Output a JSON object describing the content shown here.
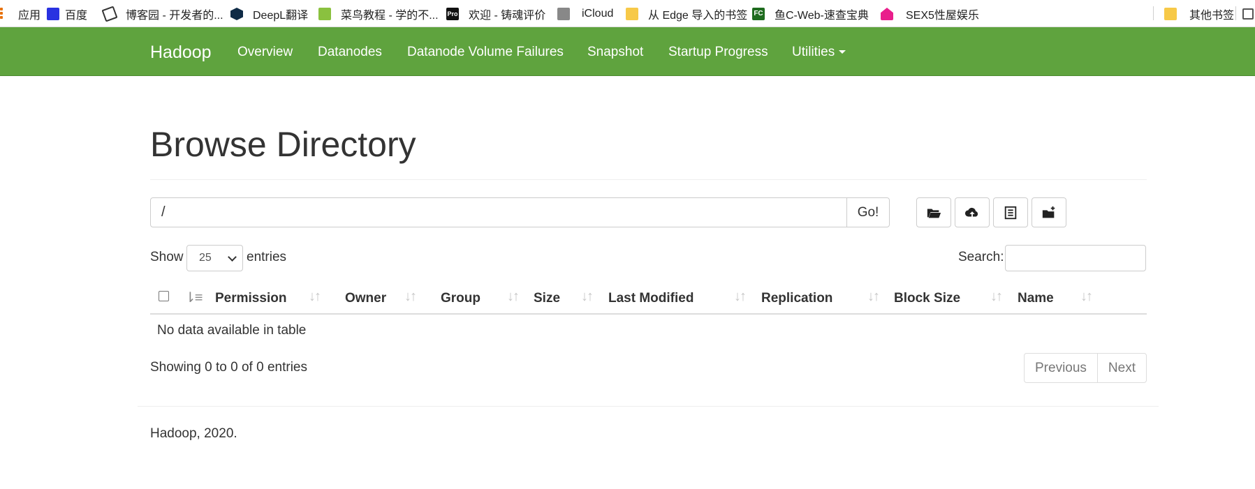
{
  "bookmarks": {
    "items": [
      {
        "label": "应用",
        "icon": "apps-grid-icon"
      },
      {
        "label": "百度",
        "icon": "baidu-paw-icon"
      },
      {
        "label": "博客园 - 开发者的...",
        "icon": "cnblogs-icon"
      },
      {
        "label": "DeepL翻译",
        "icon": "deepl-icon"
      },
      {
        "label": "菜鸟教程 - 学的不...",
        "icon": "runoob-icon"
      },
      {
        "label": "欢迎 - 铸魂评价",
        "icon": "pro-icon",
        "icon_text": "Pro"
      },
      {
        "label": "iCloud",
        "icon": "apple-icon"
      },
      {
        "label": "从 Edge 导入的书签",
        "icon": "folder-icon"
      },
      {
        "label": "鱼C-Web-速查宝典",
        "icon": "fishc-icon",
        "icon_text": "FC"
      },
      {
        "label": "SEX5性屋娱乐",
        "icon": "house-icon"
      }
    ],
    "other": {
      "label": "其他书签",
      "icon": "folder-icon"
    }
  },
  "navbar": {
    "brand": "Hadoop",
    "items": [
      "Overview",
      "Datanodes",
      "Datanode Volume Failures",
      "Snapshot",
      "Startup Progress",
      "Utilities"
    ],
    "color": "#5fa33e"
  },
  "page": {
    "title": "Browse Directory",
    "path_value": "/",
    "go_label": "Go!",
    "tools": [
      "open-folder-icon",
      "upload-cloud-icon",
      "list-icon",
      "new-folder-icon"
    ]
  },
  "table": {
    "show_label": "Show",
    "entries_value": "25",
    "entries_label": "entries",
    "search_label": "Search:",
    "columns": [
      "Permission",
      "Owner",
      "Group",
      "Size",
      "Last Modified",
      "Replication",
      "Block Size",
      "Name"
    ],
    "empty_text": "No data available in table",
    "info": "Showing 0 to 0 of 0 entries",
    "prev_label": "Previous",
    "next_label": "Next"
  },
  "footer": {
    "text": "Hadoop, 2020."
  }
}
